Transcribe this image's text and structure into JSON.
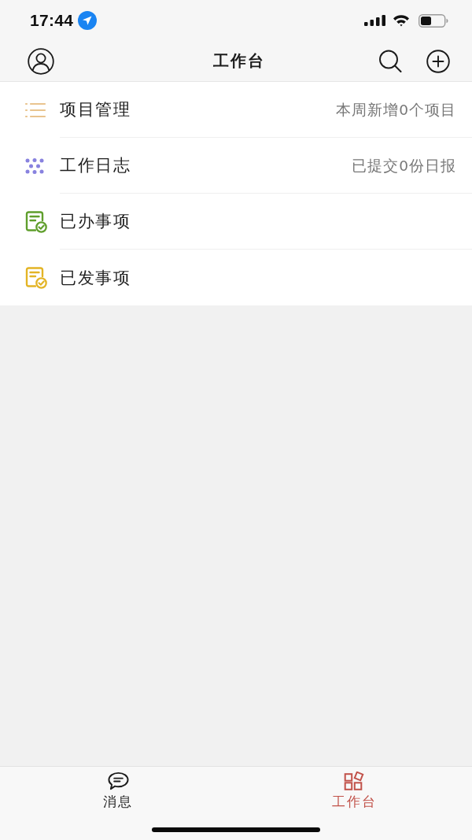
{
  "status_bar": {
    "time": "17:44"
  },
  "header": {
    "title": "工作台"
  },
  "items": [
    {
      "label": "项目管理",
      "detail": "本周新增0个项目",
      "color": "#e9c48e"
    },
    {
      "label": "工作日志",
      "detail": "已提交0份日报",
      "color": "#8882df"
    },
    {
      "label": "已办事项",
      "color": "#5f9e2c"
    },
    {
      "label": "已发事项",
      "color": "#e3b425"
    }
  ],
  "tab_bar": {
    "tabs": [
      {
        "label": "消息",
        "selected": false
      },
      {
        "label": "工作台",
        "selected": true
      }
    ]
  }
}
